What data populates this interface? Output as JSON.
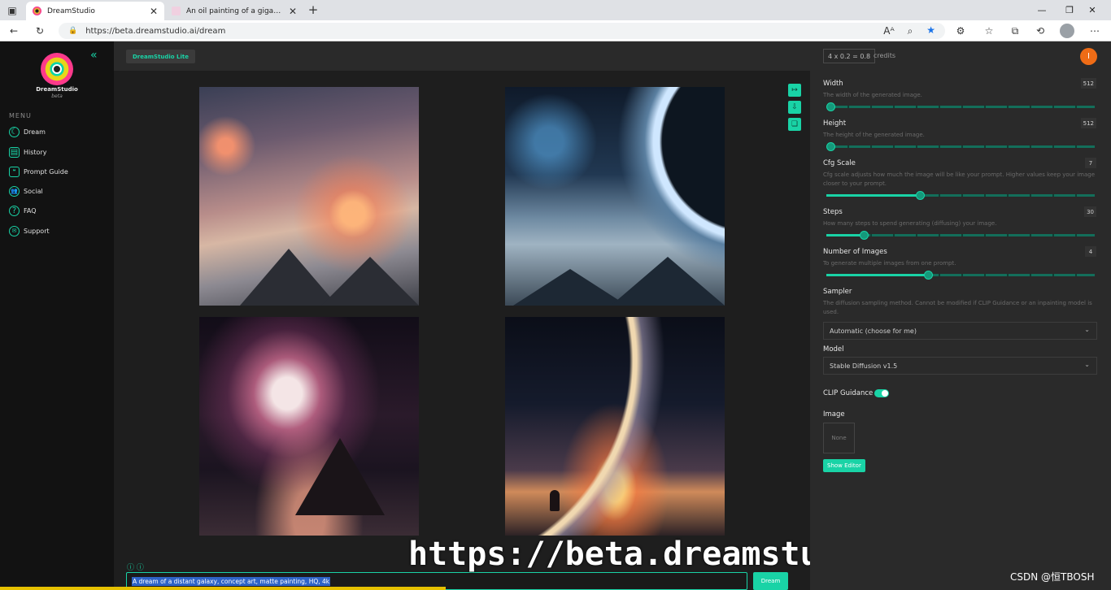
{
  "browser": {
    "tabs": [
      {
        "title": "DreamStudio",
        "active": true
      },
      {
        "title": "An oil painting of a gigachad ass",
        "active": false
      }
    ],
    "url": "https://beta.dreamstudio.ai/dream"
  },
  "sidebar": {
    "brand": "DreamStudio",
    "brand_sub": "beta",
    "menu_label": "MENU",
    "items": [
      {
        "label": "Dream",
        "icon": "dream-icon"
      },
      {
        "label": "History",
        "icon": "history-icon"
      },
      {
        "label": "Prompt Guide",
        "icon": "prompt-guide-icon"
      },
      {
        "label": "Social",
        "icon": "social-icon"
      },
      {
        "label": "FAQ",
        "icon": "faq-icon"
      },
      {
        "label": "Support",
        "icon": "support-icon"
      }
    ]
  },
  "header": {
    "badge": "DreamStudio Lite"
  },
  "prompt": {
    "text": "A dream of a distant galaxy, concept art, matte painting, HQ, 4k",
    "dream_label": "Dream"
  },
  "overlay": {
    "url_text": "https://beta.dreamstudio.ai/dream",
    "watermark": "CSDN @恒TBOSH"
  },
  "panel": {
    "credits_value": "4 x 0.2 = 0.8",
    "credits_label": "credits",
    "user_initial": "I",
    "width": {
      "title": "Width",
      "desc": "The width of the generated image.",
      "value": "512",
      "fraction": 0.0
    },
    "height": {
      "title": "Height",
      "desc": "The height of the generated image.",
      "value": "512",
      "fraction": 0.0
    },
    "cfg": {
      "title": "Cfg Scale",
      "desc": "Cfg scale adjusts how much the image will be like your prompt. Higher values keep your image closer to your prompt.",
      "value": "7",
      "fraction": 0.35
    },
    "steps": {
      "title": "Steps",
      "desc": "How many steps to spend generating (diffusing) your image.",
      "value": "30",
      "fraction": 0.14
    },
    "num_images": {
      "title": "Number of Images",
      "desc": "To generate multiple images from one prompt.",
      "value": "4",
      "fraction": 0.38
    },
    "sampler": {
      "title": "Sampler",
      "desc": "The diffusion sampling method. Cannot be modified if CLIP Guidance or an inpainting model is used.",
      "selected": "Automatic (choose for me)"
    },
    "model": {
      "title": "Model",
      "selected": "Stable Diffusion v1.5"
    },
    "clip": {
      "title": "CLIP Guidance",
      "enabled": true
    },
    "image": {
      "title": "Image",
      "value": "None",
      "button": "Show Editor"
    }
  },
  "colors": {
    "accent": "#19d3a6",
    "avatar": "#ef6c16",
    "selection": "#2e63c7"
  }
}
